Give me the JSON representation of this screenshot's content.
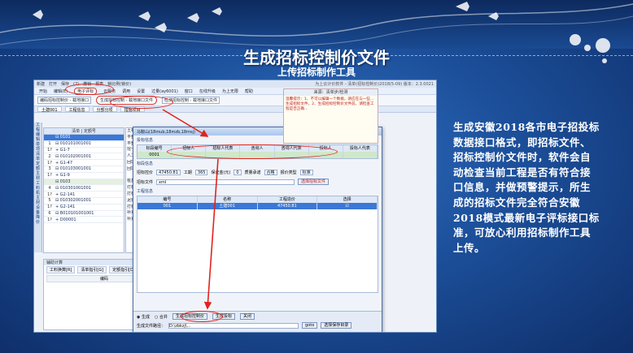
{
  "slide": {
    "title": "生成招标控制价文件",
    "subtitle": "上传招标制作工具",
    "description": "生成安徽2018各市电子招投标数据接口格式，即招标文件、招标控制价文件时，软件会自动检查当前工程是否有符合接口信息，并做预警提示，所生成的招标文件完全符合安徽2018模式最新电子评标接口标准，可放心利用招标制作工具上传。"
  },
  "app": {
    "window_title": "为上云计价软件 - 清单(招标控制价)2018(5-09) 版本：2.3.0021",
    "menu": [
      "开始",
      "编辑(E)",
      "电子评标",
      "云服务",
      "调用",
      "设置",
      "过量(ay6001)",
      "窗口",
      "在线升级",
      "为上无限",
      "帮助"
    ],
    "quick_toolbar": [
      "新建",
      "打开",
      "保存",
      "(2)",
      "撤销",
      "报表",
      "锁比例(锁价)"
    ],
    "toolbar": {
      "import_label": "编码招标控制价 - 载地接口",
      "generate_label": "生成招标控制 - 载地接口文件",
      "check_label": "检测招标控制 - 载地接口文件"
    },
    "project_tab": "土建001",
    "side_tabs": [
      "工程信息",
      "分部分项",
      "措施项目"
    ],
    "left_rail": [
      "工程",
      "编辑",
      "单项",
      "清单",
      "定额",
      "主材",
      "工料机",
      "主材设备",
      "降价"
    ],
    "tree": {
      "header": "清单 | 定额号",
      "rows": [
        {
          "n": "",
          "c": "⊟ 0101",
          "type": "sel"
        },
        {
          "n": "1",
          "c": "⊟ 010101001001",
          "type": ""
        },
        {
          "n": "1?",
          "c": "+ G1-7",
          "type": ""
        },
        {
          "n": "2",
          "c": "⊟ 010102001001",
          "type": ""
        },
        {
          "n": "1?",
          "c": "+ G1-47",
          "type": ""
        },
        {
          "n": "3",
          "c": "⊟ 010103001001",
          "type": ""
        },
        {
          "n": "1?",
          "c": "+ G1-9",
          "type": ""
        },
        {
          "n": "",
          "c": "⊟ 0103",
          "type": "grp"
        },
        {
          "n": "4",
          "c": "⊟ 010301001001",
          "type": ""
        },
        {
          "n": "1?",
          "c": "+ G2-141",
          "type": ""
        },
        {
          "n": "5",
          "c": "⊟ 010302001001",
          "type": ""
        },
        {
          "n": "1?",
          "c": "+ G2-141",
          "type": ""
        },
        {
          "n": "6",
          "c": "⊟ B010101001001",
          "type": ""
        },
        {
          "n": "1?",
          "c": "+ D00001",
          "type": ""
        }
      ]
    },
    "mid_col": [
      "土石方",
      "平整场",
      "平整场",
      "挖一般",
      "人工挖",
      "回填方",
      "回填土",
      "",
      "桩基工",
      "打桩",
      "打桩桩",
      "泥浆护",
      "打桩桩",
      "补充清",
      "补充定"
    ],
    "bottom_panel": {
      "header": "辅助计算",
      "tabs": [
        "工料换算[R]",
        "清单指引[G]",
        "定额指引[D]"
      ],
      "col": "编码"
    },
    "dialog": {
      "title": "马鞍山(18mub,18mzb,18msj)",
      "section1": "投标信息",
      "grid1_headers": [
        "标段编号",
        "招标人",
        "招标人代表",
        "咨询人",
        "咨询人代表",
        "投标人",
        "投标人代表"
      ],
      "grid1_value": "0001",
      "section2": "标段信息",
      "fields": [
        {
          "label": "招标控价",
          "value": "47450.81"
        },
        {
          "label": "工期",
          "value": "365"
        },
        {
          "label": "保证金(元)",
          "value": "0"
        },
        {
          "label": "质量承诺",
          "value": "合格"
        },
        {
          "label": "报价类型",
          "value": "标准"
        }
      ],
      "file_label": "招标文件",
      "file_value": "xml",
      "select_btn": "选择招标文件",
      "section3": "工程信息",
      "grid3_headers": [
        "编号",
        "名称",
        "工程造价",
        "选择"
      ],
      "grid3_row": [
        "001",
        "土建001",
        "47450.81",
        "☑"
      ],
      "tip_header": "来源：清单步/检测",
      "tip_text": "温馨提示：1、不可以编辑一个数据，请应在与一些…生成招标文件，2、生成招标控制价文件前，请检查工程是否正确…",
      "radio_gen": "生成",
      "radio_merge": "合并",
      "btn_gen_ctrl": "生成招标控制价",
      "btn_gen_tender": "生成投标",
      "btn_close": "关闭",
      "path_label": "生成文件路径：",
      "path_value": "D:\\zbkzj\\...",
      "goto_btn": "goto",
      "save_btn": "选择保存目录"
    }
  }
}
